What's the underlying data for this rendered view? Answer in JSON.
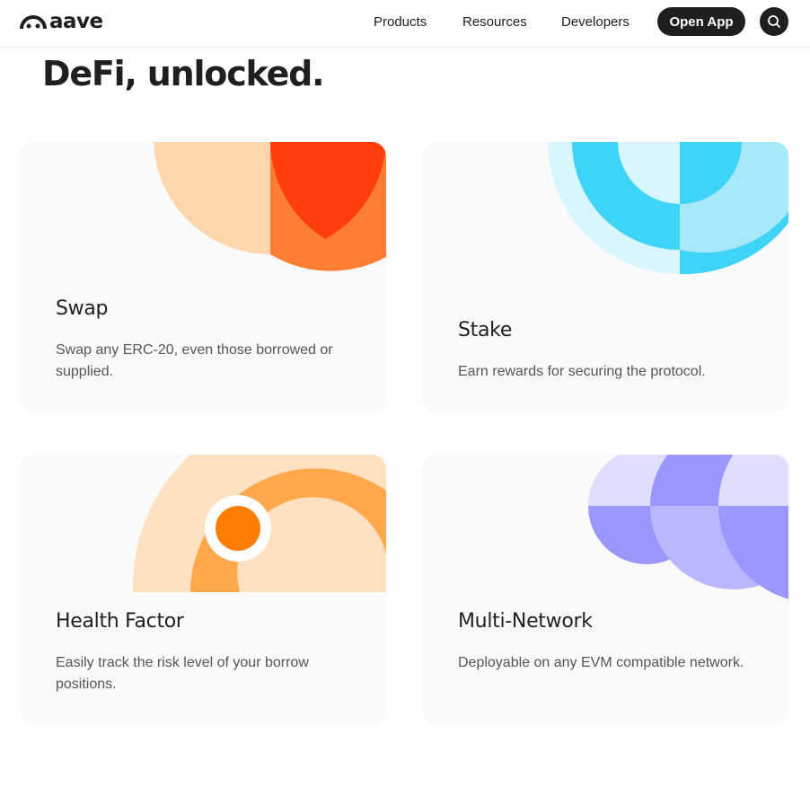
{
  "brand": {
    "name": "aave"
  },
  "nav": {
    "products": "Products",
    "resources": "Resources",
    "developers": "Developers",
    "open_app": "Open App"
  },
  "hero": {
    "title": "DeFi, unlocked."
  },
  "cards": [
    {
      "title": "Swap",
      "description": "Swap any ERC-20, even those borrowed or supplied."
    },
    {
      "title": "Stake",
      "description": "Earn rewards for securing the protocol."
    },
    {
      "title": "Health Factor",
      "description": "Easily track the risk level of your borrow positions."
    },
    {
      "title": "Multi-Network",
      "description": "Deployable on any EVM compatible network."
    }
  ],
  "colors": {
    "text": "#1f1f1f",
    "card_bg": "#fafafa",
    "swap_peach": "#fed5ad",
    "swap_red": "#ff3f0b",
    "swap_orange": "#ff7f32",
    "stake_light": "#d7f6fd",
    "stake_blue": "#3ed4f7",
    "stake_mid": "#a8e9f9",
    "hf_peach": "#ffe1c2",
    "hf_orange": "#ffa74a",
    "hf_dot": "#ff7d05",
    "mn_light": "#dfdefe",
    "mn_mid": "#bab7fe",
    "mn_dark": "#9b97fd"
  },
  "icons": {
    "logo": "aave-ghost-logo-icon",
    "search": "search-icon"
  }
}
